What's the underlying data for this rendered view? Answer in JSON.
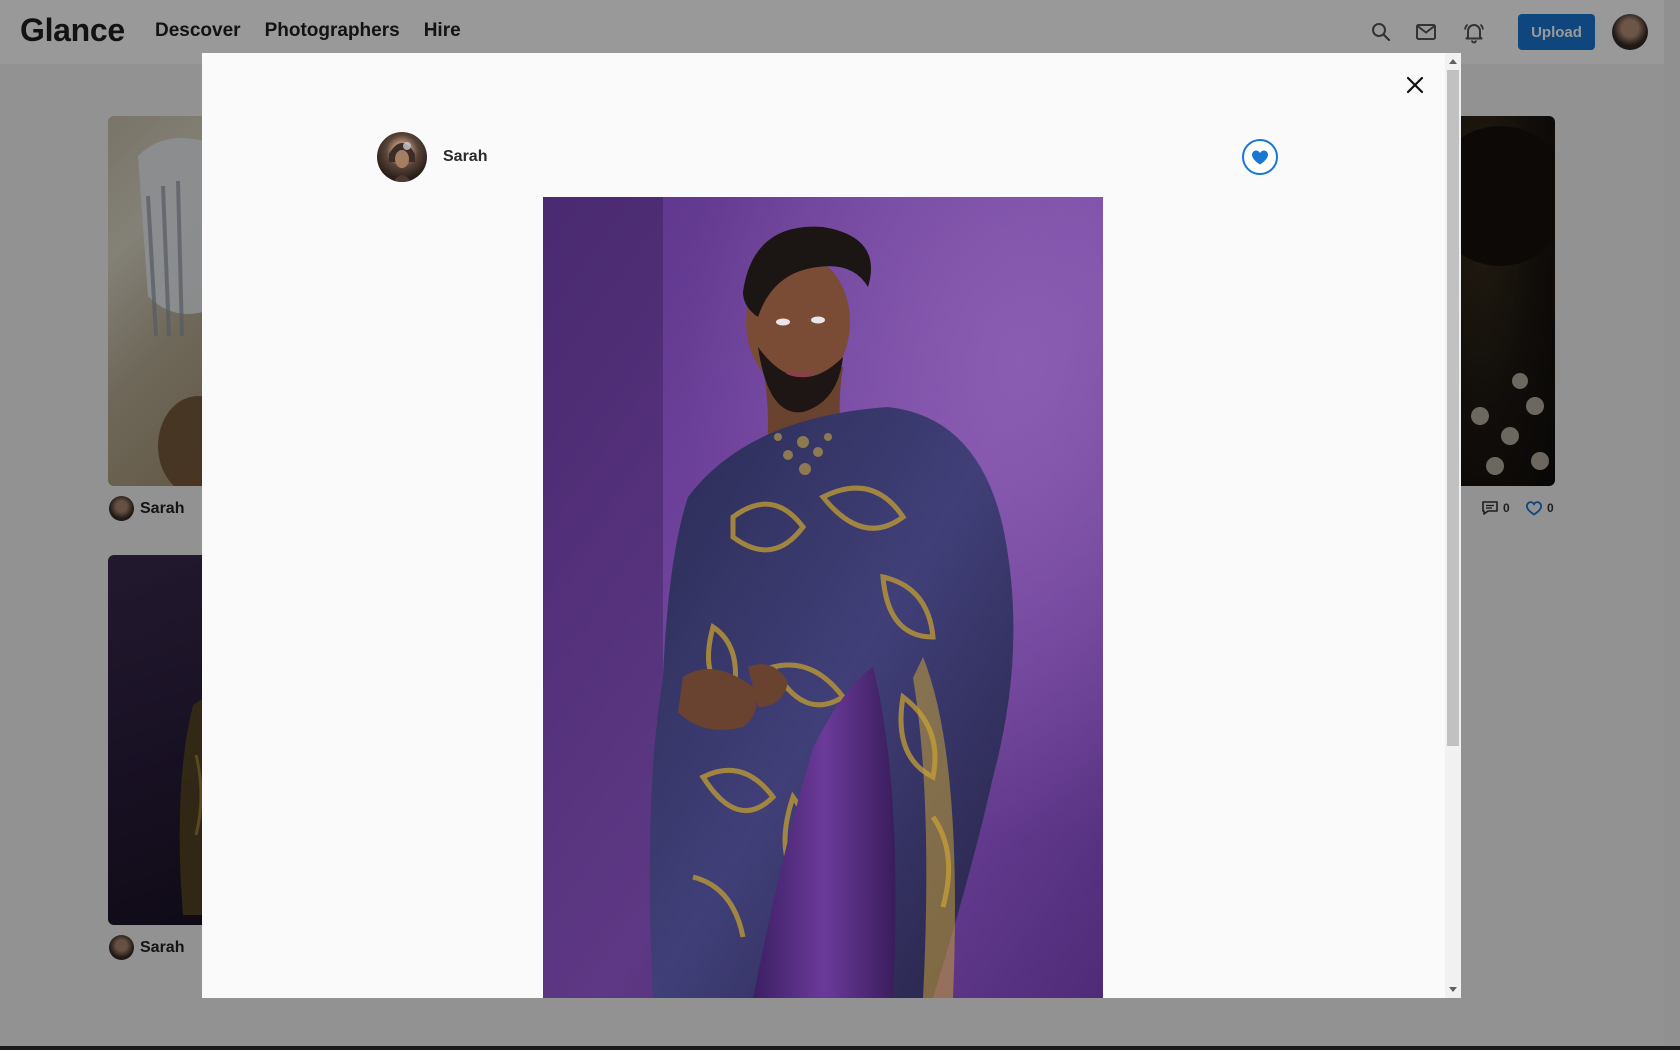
{
  "app": {
    "logo": "Glance",
    "nav": [
      "Descover",
      "Photographers",
      "Hire"
    ],
    "upload_label": "Upload",
    "icons": [
      "search-icon",
      "mail-icon",
      "bell-icon"
    ]
  },
  "feed": {
    "cards": [
      {
        "user": "Sarah"
      },
      {
        "user": "Sarah",
        "comments": "0",
        "likes": "0"
      },
      {
        "user": "Sarah"
      }
    ]
  },
  "modal": {
    "author": "Sarah",
    "close_icon": "close-icon",
    "like_icon": "heart-icon",
    "photo": "portrait-purple-backdrop-gold-paisley-shawl"
  },
  "colors": {
    "accent": "#1976d2",
    "backdrop": "rgba(0,0,0,0.4)",
    "photo_bg": "#6a3f98",
    "fabric_gold": "#b39339"
  }
}
